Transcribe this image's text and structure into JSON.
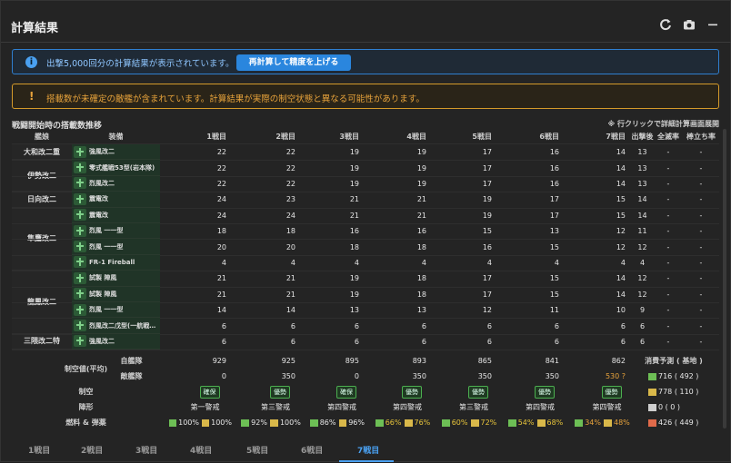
{
  "header": {
    "title": "計算結果"
  },
  "info": {
    "text": "出撃5,000回分の計算結果が表示されています。",
    "button": "再計算して精度を上げる"
  },
  "warning": {
    "text": "搭載数が未確定の敵艦が含まれています。計算結果が実際の制空状態と異なる可能性があります。"
  },
  "section": {
    "title": "戦闘開始時の搭載数推移",
    "note": "※ 行クリックで詳細計算画面展開"
  },
  "columns": [
    "艦娘",
    "装備",
    "1戦目",
    "2戦目",
    "3戦目",
    "4戦目",
    "5戦目",
    "6戦目",
    "7戦目",
    "出撃後",
    "全滅率",
    "棒立ち率"
  ],
  "ships": [
    "大和改二重",
    "伊勢改二",
    "日向改二",
    "隼鷹改二",
    "龍鳳改二",
    "三隈改二特"
  ],
  "rows": [
    {
      "eq": "強風改二",
      "v": [
        "22",
        "22",
        "19",
        "19",
        "17",
        "16",
        "14",
        "13",
        "-",
        "-"
      ]
    },
    {
      "eq": "零式艦戦53型(岩本隊)",
      "v": [
        "22",
        "22",
        "19",
        "19",
        "17",
        "16",
        "14",
        "13",
        "-",
        "-"
      ]
    },
    {
      "eq": "烈風改二",
      "v": [
        "22",
        "22",
        "19",
        "19",
        "17",
        "16",
        "14",
        "13",
        "-",
        "-"
      ]
    },
    {
      "eq": "震電改",
      "v": [
        "24",
        "23",
        "21",
        "21",
        "19",
        "17",
        "15",
        "14",
        "-",
        "-"
      ]
    },
    {
      "eq": "震電改",
      "v": [
        "24",
        "24",
        "21",
        "21",
        "19",
        "17",
        "15",
        "14",
        "-",
        "-"
      ]
    },
    {
      "eq": "烈風 一一型",
      "v": [
        "18",
        "18",
        "16",
        "16",
        "15",
        "13",
        "12",
        "11",
        "-",
        "-"
      ]
    },
    {
      "eq": "烈風 一一型",
      "v": [
        "20",
        "20",
        "18",
        "18",
        "16",
        "15",
        "12",
        "12",
        "-",
        "-"
      ]
    },
    {
      "eq": "FR-1 Fireball",
      "v": [
        "4",
        "4",
        "4",
        "4",
        "4",
        "4",
        "4",
        "4",
        "-",
        "-"
      ]
    },
    {
      "eq": "試製 陣風",
      "v": [
        "21",
        "21",
        "19",
        "18",
        "17",
        "15",
        "14",
        "12",
        "-",
        "-"
      ]
    },
    {
      "eq": "試製 陣風",
      "v": [
        "21",
        "21",
        "19",
        "18",
        "17",
        "15",
        "14",
        "12",
        "-",
        "-"
      ]
    },
    {
      "eq": "烈風 一一型",
      "v": [
        "14",
        "14",
        "13",
        "13",
        "12",
        "11",
        "10",
        "9",
        "-",
        "-"
      ]
    },
    {
      "eq": "烈風改二戊型(一航戦…",
      "v": [
        "6",
        "6",
        "6",
        "6",
        "6",
        "6",
        "6",
        "6",
        "-",
        "-"
      ]
    },
    {
      "eq": "強風改二",
      "v": [
        "6",
        "6",
        "6",
        "6",
        "6",
        "6",
        "6",
        "6",
        "-",
        "-"
      ]
    }
  ],
  "summary": {
    "air_label": "制空値(平均)",
    "own_label": "自艦隊",
    "own": [
      "929",
      "925",
      "895",
      "893",
      "865",
      "841",
      "862"
    ],
    "enemy_label": "敵艦隊",
    "enemy": [
      "0",
      "350",
      "0",
      "350",
      "350",
      "350",
      "530 ?"
    ],
    "control_label": "制空",
    "control": [
      "確保",
      "優勢",
      "確保",
      "優勢",
      "優勢",
      "優勢",
      "優勢"
    ],
    "formation_label": "陣形",
    "formation": [
      "第一警戒",
      "第三警戒",
      "第四警戒",
      "第四警戒",
      "第三警戒",
      "第四警戒",
      "第四警戒"
    ],
    "fuel_label": "燃料 & 弾薬",
    "fuel": [
      "100%",
      "92%",
      "86%",
      "66%",
      "60%",
      "54%",
      "34%"
    ],
    "ammo": [
      "100%",
      "100%",
      "96%",
      "76%",
      "72%",
      "68%",
      "48%"
    ],
    "consumption_label": "消費予測 ( 基地 )",
    "consumption": [
      "716 ( 492 )",
      "778 ( 110 )",
      "0 ( 0 )",
      "426 ( 449 )"
    ]
  },
  "tabs": [
    "1戦目",
    "2戦目",
    "3戦目",
    "4戦目",
    "5戦目",
    "6戦目",
    "7戦目"
  ],
  "active_tab": "7戦目",
  "colors": {
    "accent": "#4aa0f0",
    "warning": "#e8a33b",
    "good": "#4caf50"
  }
}
